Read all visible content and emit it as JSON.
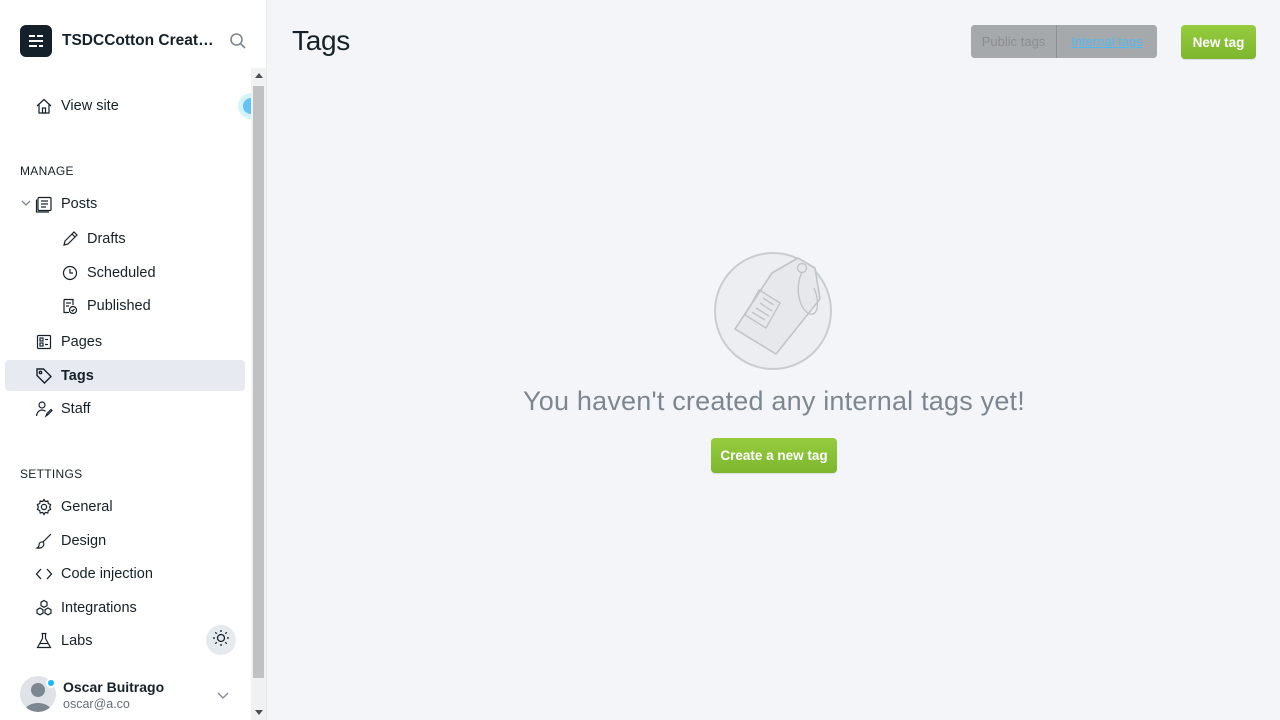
{
  "sidebar": {
    "site_title": "TSDCCotton Creations",
    "view_site": "View site",
    "manage_heading": "MANAGE",
    "settings_heading": "SETTINGS",
    "manage_items": [
      {
        "label": "Posts",
        "icon": "posts-icon"
      },
      {
        "label": "Drafts",
        "icon": "pencil-icon"
      },
      {
        "label": "Scheduled",
        "icon": "clock-icon"
      },
      {
        "label": "Published",
        "icon": "published-icon"
      },
      {
        "label": "Pages",
        "icon": "pages-icon"
      },
      {
        "label": "Tags",
        "icon": "tag-icon",
        "active": true
      },
      {
        "label": "Staff",
        "icon": "staff-icon"
      }
    ],
    "settings_items": [
      {
        "label": "General",
        "icon": "gear-icon"
      },
      {
        "label": "Design",
        "icon": "brush-icon"
      },
      {
        "label": "Code injection",
        "icon": "code-icon"
      },
      {
        "label": "Integrations",
        "icon": "integrations-icon"
      },
      {
        "label": "Labs",
        "icon": "flask-icon"
      }
    ],
    "user": {
      "name": "Oscar Buitrago",
      "email": "oscar@a.co"
    }
  },
  "main": {
    "title": "Tags",
    "filter": {
      "public_label": "Public tags",
      "internal_label": "Internal tags",
      "selected": "Internal tags"
    },
    "new_button": "New tag",
    "empty_message": "You haven't created any internal tags yet!",
    "create_button": "Create a new tag"
  },
  "colors": {
    "accent_green": "#8ac437",
    "active_bg": "#e7eaf0",
    "link_blue": "#14b8ff"
  }
}
